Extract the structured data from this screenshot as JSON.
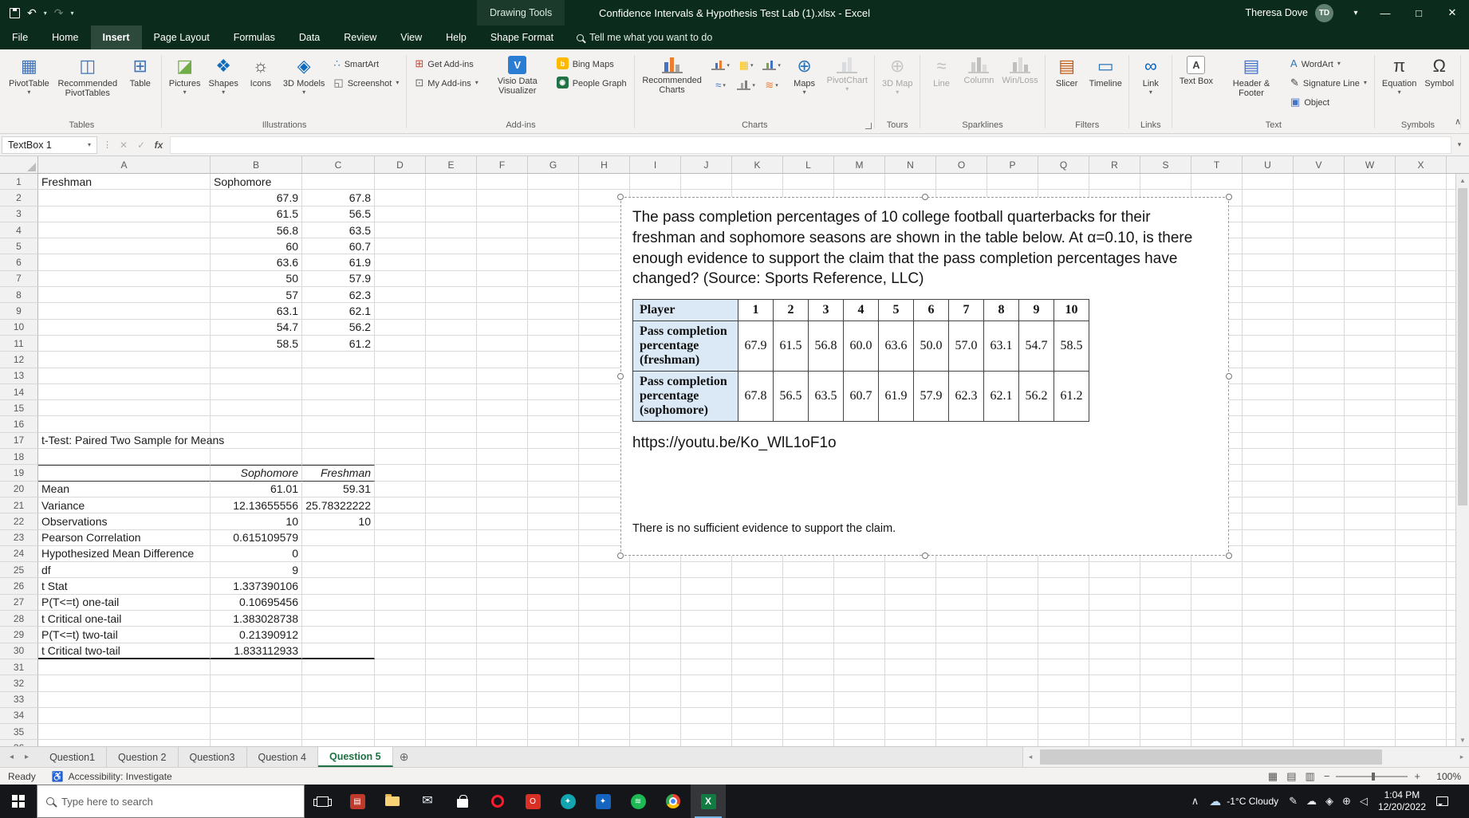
{
  "titlebar": {
    "context_group": "Drawing Tools",
    "title": "Confidence Intervals & Hypothesis Test Lab (1).xlsx  -  Excel",
    "user": {
      "name": "Theresa Dove",
      "initials": "TD"
    }
  },
  "ribbon_tabs": [
    {
      "label": "File",
      "file": true
    },
    {
      "label": "Home"
    },
    {
      "label": "Insert",
      "active": true
    },
    {
      "label": "Page Layout"
    },
    {
      "label": "Formulas"
    },
    {
      "label": "Data"
    },
    {
      "label": "Review"
    },
    {
      "label": "View"
    },
    {
      "label": "Help"
    },
    {
      "label": "Shape Format"
    }
  ],
  "tell_me": "Tell me what you want to do",
  "ribbon": {
    "groups": [
      {
        "label": "Tables",
        "items": [
          {
            "kind": "large",
            "label": "PivotTable",
            "dropdown": true,
            "icon": {
              "name": "pivottable-icon",
              "type": "glyph",
              "glyph": "▦",
              "color": "#3f74b8"
            }
          },
          {
            "kind": "large",
            "label": "Recommended PivotTables",
            "icon": {
              "name": "recommended-pivottables-icon",
              "type": "glyph",
              "glyph": "◫",
              "color": "#3f74b8"
            }
          },
          {
            "kind": "large",
            "label": "Table",
            "icon": {
              "name": "table-icon",
              "type": "glyph",
              "glyph": "⊞",
              "color": "#3f74b8"
            }
          }
        ]
      },
      {
        "label": "Illustrations",
        "items": [
          {
            "kind": "large",
            "label": "Pictures",
            "dropdown": true,
            "icon": {
              "name": "pictures-icon",
              "type": "glyph",
              "glyph": "◪",
              "color": "#70ad47"
            }
          },
          {
            "kind": "large",
            "label": "Shapes",
            "dropdown": true,
            "icon": {
              "name": "shapes-icon",
              "type": "glyph",
              "glyph": "❖",
              "color": "#0f6cbd"
            }
          },
          {
            "kind": "large",
            "label": "Icons",
            "icon": {
              "name": "icons-icon",
              "type": "glyph",
              "glyph": "☼",
              "color": "#444444"
            }
          },
          {
            "kind": "large",
            "label": "3D Models",
            "dropdown": true,
            "icon": {
              "name": "3d-models-icon",
              "type": "glyph",
              "glyph": "◈",
              "color": "#0f6cbd"
            }
          },
          {
            "kind": "stack",
            "items": [
              {
                "kind": "small",
                "label": "SmartArt",
                "icon": {
                  "name": "smartart-icon",
                  "type": "glyph",
                  "glyph": "∴",
                  "color": "#2e75b6"
                }
              },
              {
                "kind": "small",
                "label": "Screenshot",
                "dropdown": true,
                "icon": {
                  "name": "screenshot-icon",
                  "type": "glyph",
                  "glyph": "◱",
                  "color": "#666666"
                }
              }
            ]
          }
        ]
      },
      {
        "label": "Add-ins",
        "items": [
          {
            "kind": "stack",
            "items": [
              {
                "kind": "small",
                "label": "Get Add-ins",
                "icon": {
                  "name": "get-add-ins-icon",
                  "type": "glyph",
                  "glyph": "⊞",
                  "color": "#c74634"
                }
              },
              {
                "kind": "small",
                "label": "My Add-ins",
                "dropdown": true,
                "icon": {
                  "name": "my-add-ins-icon",
                  "type": "glyph",
                  "glyph": "⊡",
                  "color": "#666666"
                }
              }
            ]
          },
          {
            "kind": "large",
            "label": "Visio Data Visualizer",
            "icon": {
              "name": "visio-data-visualizer-icon",
              "type": "badge",
              "glyph": "V",
              "bg": "#2b7cd3"
            }
          },
          {
            "kind": "stack",
            "items": [
              {
                "kind": "small",
                "label": "Bing Maps",
                "icon": {
                  "name": "bing-maps-icon",
                  "type": "badge",
                  "glyph": "b",
                  "bg": "#ffb900"
                }
              },
              {
                "kind": "small",
                "label": "People Graph",
                "icon": {
                  "name": "people-graph-icon",
                  "type": "badge",
                  "glyph": "◉",
                  "bg": "#217346"
                }
              }
            ]
          }
        ]
      },
      {
        "label": "Charts",
        "launcher": true,
        "items": [
          {
            "kind": "large",
            "label": "Recommended Charts",
            "icon": {
              "name": "recommended-charts-icon",
              "type": "bars",
              "colors": [
                "#4472c4",
                "#ed7d31",
                "#a5a5a5"
              ]
            }
          },
          {
            "kind": "chartgrid",
            "rows": [
              [
                {
                  "name": "insert-column-chart-icon",
                  "type": "bars",
                  "colors": [
                    "#4472c4",
                    "#ed7d31"
                  ]
                },
                {
                  "name": "insert-hierarchy-chart-icon",
                  "type": "glyph",
                  "glyph": "▦",
                  "color": "#ffc000"
                },
                {
                  "name": "insert-waterfall-chart-icon",
                  "type": "bars",
                  "colors": [
                    "#70ad47",
                    "#4472c4"
                  ]
                }
              ],
              [
                {
                  "name": "insert-line-chart-icon",
                  "type": "glyph",
                  "glyph": "≈",
                  "color": "#4472c4"
                },
                {
                  "name": "insert-statistic-chart-icon",
                  "type": "bars",
                  "colors": [
                    "#a5a5a5",
                    "#7f7f7f"
                  ]
                },
                {
                  "name": "insert-combo-chart-icon",
                  "type": "glyph",
                  "glyph": "≋",
                  "color": "#ed7d31"
                }
              ]
            ]
          },
          {
            "kind": "large",
            "label": "Maps",
            "dropdown": true,
            "icon": {
              "name": "maps-icon",
              "type": "glyph",
              "glyph": "⊕",
              "color": "#2e75b6"
            }
          },
          {
            "kind": "large",
            "label": "PivotChart",
            "dropdown": true,
            "disabled": true,
            "icon": {
              "name": "pivotchart-icon",
              "type": "bars",
              "colors": [
                "#9dc3e6",
                "#c9c9c9"
              ]
            }
          }
        ]
      },
      {
        "label": "Tours",
        "items": [
          {
            "kind": "large",
            "label": "3D Map",
            "dropdown": true,
            "disabled": true,
            "icon": {
              "name": "3d-map-icon",
              "type": "glyph",
              "glyph": "⊕",
              "color": "#8a8a8a"
            }
          }
        ]
      },
      {
        "label": "Sparklines",
        "items": [
          {
            "kind": "large",
            "label": "Line",
            "disabled": true,
            "icon": {
              "name": "sparkline-line-icon",
              "type": "glyph",
              "glyph": "≈",
              "color": "#7a7a7a"
            }
          },
          {
            "kind": "large",
            "label": "Column",
            "disabled": true,
            "icon": {
              "name": "sparkline-column-icon",
              "type": "bars",
              "colors": [
                "#9a9a9a",
                "#7a7a7a",
                "#bdbdbd"
              ]
            }
          },
          {
            "kind": "large",
            "label": "Win/Loss",
            "disabled": true,
            "icon": {
              "name": "sparkline-winloss-icon",
              "type": "bars",
              "colors": [
                "#7a7a7a",
                "#bdbdbd",
                "#7a7a7a"
              ]
            }
          }
        ]
      },
      {
        "label": "Filters",
        "items": [
          {
            "kind": "large",
            "label": "Slicer",
            "icon": {
              "name": "slicer-icon",
              "type": "glyph",
              "glyph": "▤",
              "color": "#c55a11"
            }
          },
          {
            "kind": "large",
            "label": "Timeline",
            "icon": {
              "name": "timeline-icon",
              "type": "glyph",
              "glyph": "▭",
              "color": "#2e75b6"
            }
          }
        ]
      },
      {
        "label": "Links",
        "items": [
          {
            "kind": "large",
            "label": "Link",
            "dropdown": true,
            "icon": {
              "name": "link-icon",
              "type": "glyph",
              "glyph": "∞",
              "color": "#0563c1"
            }
          }
        ]
      },
      {
        "label": "Text",
        "items": [
          {
            "kind": "large",
            "label": "Text Box",
            "icon": {
              "name": "text-box-icon",
              "type": "badge",
              "glyph": "A",
              "bg": "#ffffff",
              "fg": "#444444",
              "border": true
            }
          },
          {
            "kind": "large",
            "label": "Header & Footer",
            "icon": {
              "name": "header-footer-icon",
              "type": "glyph",
              "glyph": "▤",
              "color": "#4472c4"
            }
          },
          {
            "kind": "stack",
            "items": [
              {
                "kind": "small",
                "label": "WordArt",
                "dropdown": true,
                "icon": {
                  "name": "wordart-icon",
                  "type": "glyph",
                  "glyph": "A",
                  "color": "#2e75b6"
                }
              },
              {
                "kind": "small",
                "label": "Signature Line",
                "dropdown": true,
                "icon": {
                  "name": "signature-line-icon",
                  "type": "glyph",
                  "glyph": "✎",
                  "color": "#444444"
                }
              },
              {
                "kind": "small",
                "label": "Object",
                "icon": {
                  "name": "object-icon",
                  "type": "glyph",
                  "glyph": "▣",
                  "color": "#4472c4"
                }
              }
            ]
          }
        ]
      },
      {
        "label": "Symbols",
        "items": [
          {
            "kind": "large",
            "label": "Equation",
            "dropdown": true,
            "icon": {
              "name": "equation-icon",
              "type": "glyph",
              "glyph": "π",
              "color": "#3b3b3b"
            }
          },
          {
            "kind": "large",
            "label": "Symbol",
            "icon": {
              "name": "symbol-icon",
              "type": "glyph",
              "glyph": "Ω",
              "color": "#3b3b3b"
            }
          }
        ]
      }
    ]
  },
  "formula_bar": {
    "name_box": "TextBox 1",
    "fx_label": "fx",
    "value": ""
  },
  "sheet": {
    "columns": [
      "A",
      "B",
      "C",
      "D",
      "E",
      "F",
      "G",
      "H",
      "I",
      "J",
      "K",
      "L",
      "M",
      "N",
      "O",
      "P",
      "Q",
      "R",
      "S",
      "T",
      "U",
      "V",
      "W",
      "X"
    ],
    "visible_rows": 36,
    "data_table": {
      "freshman_label": "Freshman",
      "sophomore_label": "Sophomore",
      "freshman": [
        "67.9",
        "61.5",
        "56.8",
        "60",
        "63.6",
        "50",
        "57",
        "63.1",
        "54.7",
        "58.5"
      ],
      "sophomore": [
        "67.8",
        "56.5",
        "63.5",
        "60.7",
        "61.9",
        "57.9",
        "62.3",
        "62.1",
        "56.2",
        "61.2"
      ]
    },
    "t_test": {
      "title": "t-Test: Paired Two Sample for Means",
      "col_headers": [
        "Sophomore",
        "Freshman"
      ],
      "rows": [
        {
          "label": "Mean",
          "v1": "61.01",
          "v2": "59.31"
        },
        {
          "label": "Variance",
          "v1": "12.13655556",
          "v2": "25.78322222"
        },
        {
          "label": "Observations",
          "v1": "10",
          "v2": "10"
        },
        {
          "label": "Pearson Correlation",
          "v1": "0.615109579",
          "v2": ""
        },
        {
          "label": "Hypothesized Mean Difference",
          "v1": "0",
          "v2": ""
        },
        {
          "label": "df",
          "v1": "9",
          "v2": ""
        },
        {
          "label": "t Stat",
          "v1": "1.337390106",
          "v2": ""
        },
        {
          "label": "P(T<=t) one-tail",
          "v1": "0.10695456",
          "v2": ""
        },
        {
          "label": "t Critical one-tail",
          "v1": "1.383028738",
          "v2": ""
        },
        {
          "label": "P(T<=t) two-tail",
          "v1": "0.21390912",
          "v2": ""
        },
        {
          "label": "t Critical two-tail",
          "v1": "1.833112933",
          "v2": ""
        }
      ]
    }
  },
  "textbox": {
    "paragraph": "The pass completion percentages of 10  college football quarterbacks for their freshman and sophomore seasons are shown in the table below. At α=0.10, is there enough evidence to support the claim that the pass completion percentages have changed? (Source: Sports Reference, LLC)",
    "table": {
      "header_label": "Player",
      "player_numbers": [
        "1",
        "2",
        "3",
        "4",
        "5",
        "6",
        "7",
        "8",
        "9",
        "10"
      ],
      "rows": [
        {
          "label": "Pass completion percentage (freshman)",
          "values": [
            "67.9",
            "61.5",
            "56.8",
            "60.0",
            "63.6",
            "50.0",
            "57.0",
            "63.1",
            "54.7",
            "58.5"
          ]
        },
        {
          "label": "Pass completion percentage (sophomore)",
          "values": [
            "67.8",
            "56.5",
            "63.5",
            "60.7",
            "61.9",
            "57.9",
            "62.3",
            "62.1",
            "56.2",
            "61.2"
          ]
        }
      ]
    },
    "link": "https://youtu.be/Ko_WlL1oF1o",
    "answer": "There is no sufficient evidence to support the claim."
  },
  "sheet_tabs": [
    {
      "label": "Question1"
    },
    {
      "label": "Question 2"
    },
    {
      "label": "Question3"
    },
    {
      "label": "Question 4"
    },
    {
      "label": "Question 5",
      "active": true
    }
  ],
  "status_bar": {
    "ready": "Ready",
    "accessibility": "Accessibility: Investigate",
    "zoom": "100%"
  },
  "taskbar": {
    "search_placeholder": "Type here to search",
    "apps": [
      {
        "name": "task-view-icon",
        "type": "taskview"
      },
      {
        "name": "pinned-app-icon-1",
        "type": "square",
        "bg": "#c0392b",
        "glyph": "▤"
      },
      {
        "name": "file-explorer-icon",
        "type": "folder"
      },
      {
        "name": "mail-icon",
        "type": "glyph",
        "glyph": "✉",
        "color": "#eef3f8"
      },
      {
        "name": "store-icon",
        "type": "bag"
      },
      {
        "name": "opera-icon",
        "type": "ring",
        "color": "#ff1b2d"
      },
      {
        "name": "pinned-app-icon-2",
        "type": "square",
        "bg": "#d93025",
        "glyph": "O"
      },
      {
        "name": "pinned-app-icon-3",
        "type": "circle",
        "bg": "#12a5b0",
        "glyph": "✦"
      },
      {
        "name": "pinned-app-icon-4",
        "type": "square",
        "bg": "#1565c0",
        "glyph": "✦"
      },
      {
        "name": "spotify-icon",
        "type": "circle",
        "bg": "#1db954",
        "glyph": "≋"
      },
      {
        "name": "chrome-icon",
        "type": "chrome"
      },
      {
        "name": "excel-icon",
        "type": "excel",
        "active": true
      }
    ],
    "tray": {
      "weather": {
        "glyph": "☁",
        "label": "-1°C Cloudy"
      },
      "icons": [
        {
          "name": "pen-icon",
          "glyph": "✎"
        },
        {
          "name": "onedrive-icon",
          "glyph": "☁"
        },
        {
          "name": "security-icon",
          "glyph": "◈"
        },
        {
          "name": "network-icon",
          "glyph": "⊕"
        },
        {
          "name": "volume-icon",
          "glyph": "◁"
        }
      ],
      "time": "1:04 PM",
      "date": "12/20/2022"
    }
  }
}
